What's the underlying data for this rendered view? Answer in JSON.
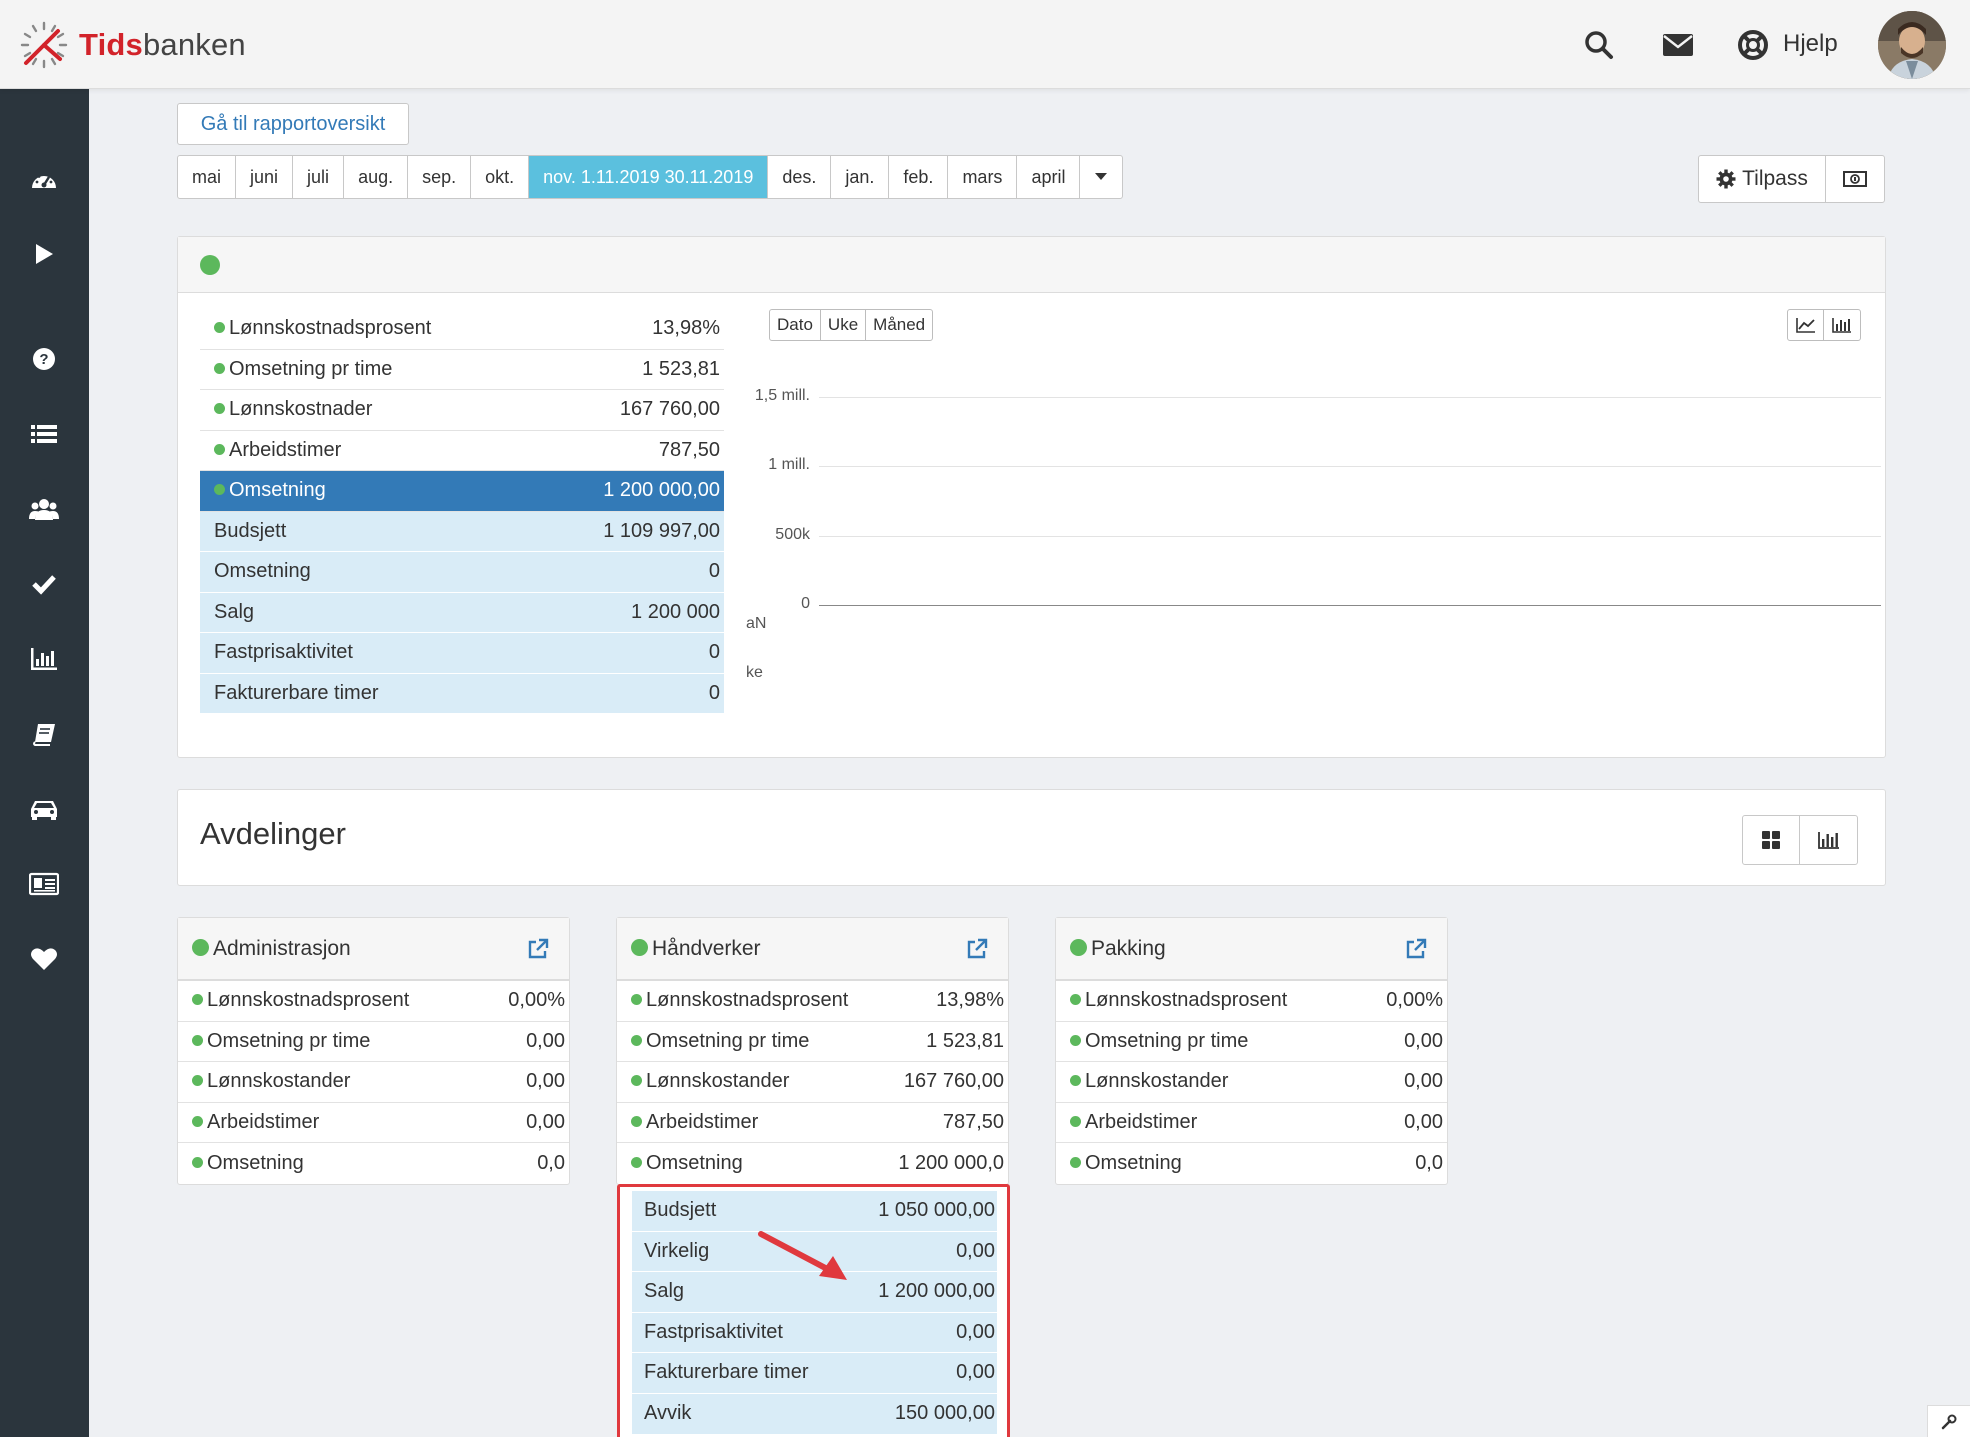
{
  "brand": {
    "name_bold": "Tids",
    "name_light": "banken"
  },
  "header": {
    "help_label": "Hjelp",
    "icons": [
      "search-icon",
      "mail-icon",
      "lifebuoy-icon"
    ]
  },
  "sidebar": {
    "icons": [
      "dashboard-icon",
      "play-icon",
      "help-circle-icon",
      "list-icon",
      "users-icon",
      "check-icon",
      "bar-chart-icon",
      "book-icon",
      "car-icon",
      "id-card-icon",
      "heart-icon"
    ]
  },
  "report": {
    "overview_button": "Gå til rapportoversikt",
    "months": [
      "mai",
      "juni",
      "juli",
      "aug.",
      "sep.",
      "okt.",
      "nov. 1.11.2019 30.11.2019",
      "des.",
      "jan.",
      "feb.",
      "mars",
      "april"
    ],
    "active_month_index": 6,
    "customize_button": "Tilpass"
  },
  "summary": {
    "kpis": [
      {
        "label": "Lønnskostnadsprosent",
        "value": "13,98%"
      },
      {
        "label": "Omsetning pr time",
        "value": "1 523,81"
      },
      {
        "label": "Lønnskostnader",
        "value": "167 760,00"
      },
      {
        "label": "Arbeidstimer",
        "value": "787,50"
      },
      {
        "label": "Omsetning",
        "value": "1 200 000,00"
      }
    ],
    "breakdown": [
      {
        "label": "Budsjett",
        "value": "1 109 997,00"
      },
      {
        "label": "Omsetning",
        "value": "0"
      },
      {
        "label": "Salg",
        "value": "1 200 000"
      },
      {
        "label": "Fastprisaktivitet",
        "value": "0"
      },
      {
        "label": "Fakturerbare timer",
        "value": "0"
      }
    ],
    "tabs": [
      "Dato",
      "Uke",
      "Måned"
    ],
    "y_ticks": [
      "1,5 mill.",
      "1 mill.",
      "500k",
      "0"
    ],
    "cut_labels": [
      "aN",
      "ke"
    ]
  },
  "departments": {
    "title": "Avdelinger",
    "items": [
      {
        "name": "Administrasjon",
        "rows": [
          {
            "label": "Lønnskostnadsprosent",
            "value": "0,00%"
          },
          {
            "label": "Omsetning pr time",
            "value": "0,00"
          },
          {
            "label": "Lønnskostander",
            "value": "0,00"
          },
          {
            "label": "Arbeidstimer",
            "value": "0,00"
          },
          {
            "label": "Omsetning",
            "value": "0,0"
          }
        ]
      },
      {
        "name": "Håndverker",
        "rows": [
          {
            "label": "Lønnskostnadsprosent",
            "value": "13,98%"
          },
          {
            "label": "Omsetning pr time",
            "value": "1 523,81"
          },
          {
            "label": "Lønnskostander",
            "value": "167 760,00"
          },
          {
            "label": "Arbeidstimer",
            "value": "787,50"
          },
          {
            "label": "Omsetning",
            "value": "1 200 000,0"
          }
        ]
      },
      {
        "name": "Pakking",
        "rows": [
          {
            "label": "Lønnskostnadsprosent",
            "value": "0,00%"
          },
          {
            "label": "Omsetning pr time",
            "value": "0,00"
          },
          {
            "label": "Lønnskostander",
            "value": "0,00"
          },
          {
            "label": "Arbeidstimer",
            "value": "0,00"
          },
          {
            "label": "Omsetning",
            "value": "0,0"
          }
        ]
      }
    ],
    "expanded_breakdown": [
      {
        "label": "Budsjett",
        "value": "1 050 000,00"
      },
      {
        "label": "Virkelig",
        "value": "0,00"
      },
      {
        "label": "Salg",
        "value": "1 200 000,00"
      },
      {
        "label": "Fastprisaktivitet",
        "value": "0,00"
      },
      {
        "label": "Fakturerbare timer",
        "value": "0,00"
      },
      {
        "label": "Avvik",
        "value": "150 000,00"
      }
    ]
  },
  "colors": {
    "status_green": "#5cb85c",
    "active_month": "#5bc0de",
    "selected_row": "#337ab7",
    "highlight_red": "#e0393e"
  }
}
